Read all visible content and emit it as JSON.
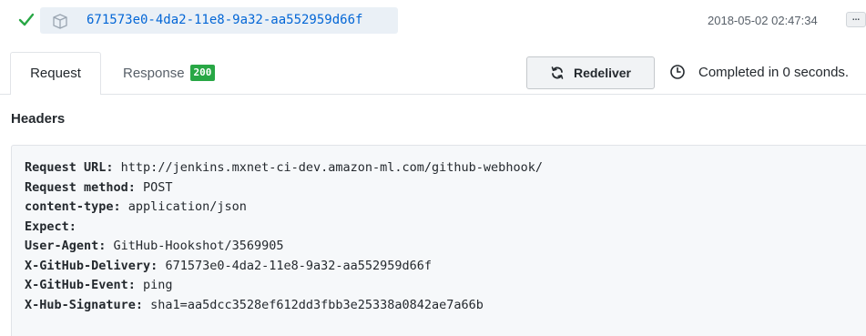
{
  "delivery": {
    "guid": "671573e0-4da2-11e8-9a32-aa552959d66f",
    "timestamp": "2018-05-02 02:47:34",
    "more_label": "...",
    "status_color": "#28a745"
  },
  "tabs": {
    "request_label": "Request",
    "response_label": "Response",
    "response_badge": "200",
    "active": "Request"
  },
  "actions": {
    "redeliver_label": "Redeliver",
    "completed_text": "Completed in 0 seconds."
  },
  "headers": {
    "title": "Headers",
    "lines": [
      {
        "key": "Request URL:",
        "value": " http://jenkins.mxnet-ci-dev.amazon-ml.com/github-webhook/"
      },
      {
        "key": "Request method:",
        "value": " POST"
      },
      {
        "key": "content-type:",
        "value": " application/json"
      },
      {
        "key": "Expect:",
        "value": ""
      },
      {
        "key": "User-Agent:",
        "value": " GitHub-Hookshot/3569905"
      },
      {
        "key": "X-GitHub-Delivery:",
        "value": " 671573e0-4da2-11e8-9a32-aa552959d66f"
      },
      {
        "key": "X-GitHub-Event:",
        "value": " ping"
      },
      {
        "key": "X-Hub-Signature:",
        "value": " sha1=aa5dcc3528ef612dd3fbb3e25338a0842ae7a66b"
      }
    ]
  },
  "icons": {
    "status": "check-icon",
    "delivery": "package-icon",
    "redeliver": "sync-icon",
    "time": "clock-icon"
  }
}
